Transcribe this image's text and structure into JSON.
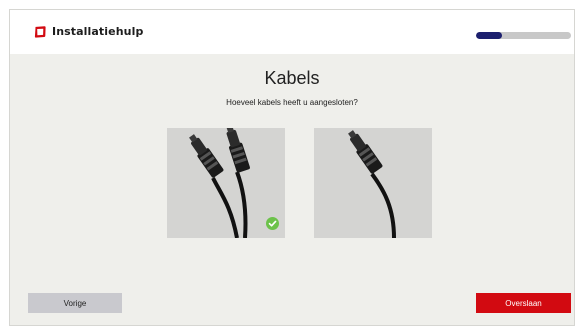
{
  "header": {
    "title": "Installatiehulp",
    "logo_icon": "tv-logo-icon",
    "progress": 0.27,
    "colors": {
      "brand": "#d20a11",
      "progress": "#1c1f6e"
    }
  },
  "main": {
    "heading": "Kabels",
    "subheading": "Hoeveel kabels heeft u aangesloten?",
    "options": [
      {
        "icon": "two-cables-icon",
        "selected": true
      },
      {
        "icon": "one-cable-icon",
        "selected": false
      }
    ],
    "selected_icon": "checkmark-icon",
    "selected_color": "#6cc24a"
  },
  "footer": {
    "previous_label": "Vorige",
    "skip_label": "Overslaan"
  }
}
